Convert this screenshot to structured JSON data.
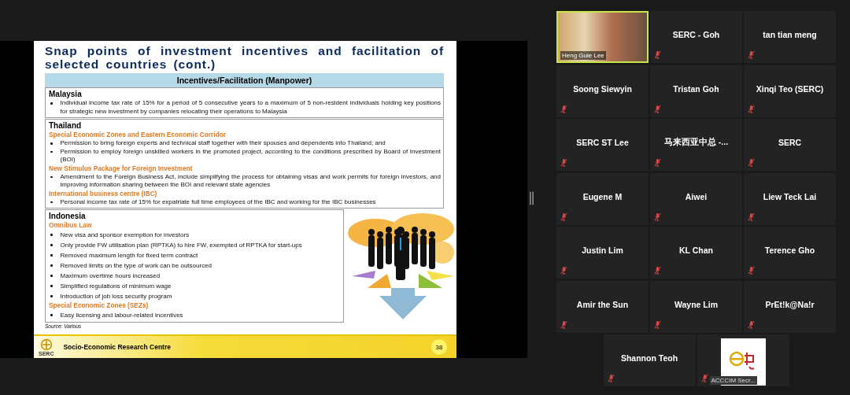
{
  "slide": {
    "title": "Snap points of investment incentives and facilitation of selected countries (cont.)",
    "table_header": "Incentives/Facilitation (Manpower)",
    "sections": [
      {
        "country": "Malaysia",
        "groups": [
          {
            "bullets": [
              "Individual income tax rate of 15% for a period of 5 consecutive years to a maximum of 5 non-resident individuals holding key positions for strategic new investment by companies relocating their operations to Malaysia"
            ]
          }
        ]
      },
      {
        "country": "Thailand",
        "groups": [
          {
            "heading": "Special Economic Zones and Eastern Economic Corridor",
            "bullets": [
              "Permission to bring foreign experts and technical staff together with their spouses and dependents into Thailand; and",
              "Permission to employ foreign unskilled workers in the promoted project, according to the conditions prescribed by Board of Investment (BOI)"
            ]
          },
          {
            "heading": "New Stimulus Package for Foreign Investment",
            "bullets": [
              "Amendment to the Foreign Business Act, include simplifying the process for obtaining visas and work permits for foreign investors, and improving information sharing between the BOI and relevant state agencies"
            ]
          },
          {
            "heading": "International business centre (IBC)",
            "bullets": [
              "Personal income tax rate of 15% for expatriate full time employees of the IBC and working for the IBC businesses"
            ]
          }
        ]
      },
      {
        "country": "Indonesia",
        "groups": [
          {
            "heading": "Omnibus Law",
            "bullets": [
              "New visa and sponsor exemption for investors",
              "Only provide FW utilisation plan (RPTKA) to hire FW, exempted of RPTKA for start-ups",
              "Removed maximum length for fixed term contract",
              "Removed limits on the type of work can be outsourced",
              "Maximum overtime hours increased",
              "Simplified regulations of minimum wage",
              "Introduction of job loss security program"
            ]
          },
          {
            "heading": "Special Economic Zones (SEZs)",
            "bullets": [
              "Easy licensing and labour-related incentives"
            ]
          }
        ]
      }
    ],
    "source": "Source:  Various",
    "logo_text": "SERC",
    "organisation": "Socio-Economic Research Centre",
    "page_number": "38"
  },
  "participants": [
    {
      "name": "Heng Guie Lee",
      "kind": "video",
      "muted": false,
      "speaking": true
    },
    {
      "name": "SERC - Goh",
      "kind": "name",
      "muted": true,
      "speaking": false
    },
    {
      "name": "tan tian meng",
      "kind": "name",
      "muted": true,
      "speaking": false
    },
    {
      "name": "Soong Siewyin",
      "kind": "name",
      "muted": true,
      "speaking": false
    },
    {
      "name": "Tristan Goh",
      "kind": "name",
      "muted": true,
      "speaking": false
    },
    {
      "name": "Xinqi Teo (SERC)",
      "kind": "name",
      "muted": true,
      "speaking": false
    },
    {
      "name": "SERC ST Lee",
      "kind": "name",
      "muted": true,
      "speaking": false
    },
    {
      "name": "马来西亚中总 -...",
      "kind": "name",
      "muted": true,
      "speaking": false
    },
    {
      "name": "SERC",
      "kind": "name",
      "muted": true,
      "speaking": false
    },
    {
      "name": "Eugene M",
      "kind": "name",
      "muted": true,
      "speaking": false
    },
    {
      "name": "Aiwei",
      "kind": "name",
      "muted": true,
      "speaking": false
    },
    {
      "name": "Liew Teck Lai",
      "kind": "name",
      "muted": true,
      "speaking": false
    },
    {
      "name": "Justin Lim",
      "kind": "name",
      "muted": true,
      "speaking": false
    },
    {
      "name": "KL Chan",
      "kind": "name",
      "muted": true,
      "speaking": false
    },
    {
      "name": "Terence Gho",
      "kind": "name",
      "muted": true,
      "speaking": false
    },
    {
      "name": "Amir the Sun",
      "kind": "name",
      "muted": true,
      "speaking": false
    },
    {
      "name": "Wayne Lim",
      "kind": "name",
      "muted": true,
      "speaking": false
    },
    {
      "name": "PrEt!k@Na!r",
      "kind": "name",
      "muted": true,
      "speaking": false
    },
    {
      "name": "Shannon Teoh",
      "kind": "name",
      "muted": true,
      "speaking": false
    },
    {
      "name": "ACCCIM Secr...",
      "kind": "picture",
      "muted": true,
      "speaking": false
    }
  ]
}
